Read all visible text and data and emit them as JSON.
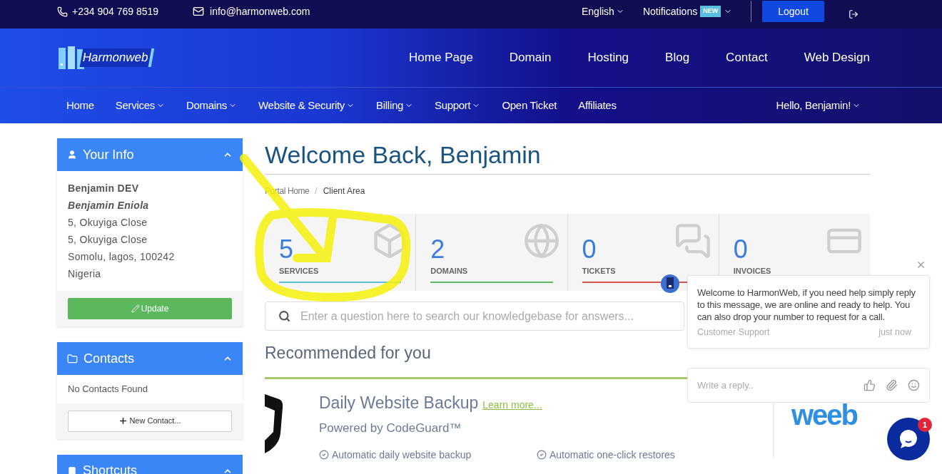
{
  "top_bar": {
    "phone": "+234 904 769 8519",
    "email": "info@harmonweb.com",
    "language": "English",
    "notifications": "Notifications",
    "notifications_badge": "NEW",
    "logout": "Logout"
  },
  "logo": {
    "text": "Harmonweb"
  },
  "main_nav": [
    "Home Page",
    "Domain",
    "Hosting",
    "Blog",
    "Contact",
    "Web Design"
  ],
  "sub_nav": [
    {
      "label": "Home",
      "dropdown": false
    },
    {
      "label": "Services",
      "dropdown": true
    },
    {
      "label": "Domains",
      "dropdown": true
    },
    {
      "label": "Website & Security",
      "dropdown": true
    },
    {
      "label": "Billing",
      "dropdown": true
    },
    {
      "label": "Support",
      "dropdown": true
    },
    {
      "label": "Open Ticket",
      "dropdown": false
    },
    {
      "label": "Affiliates",
      "dropdown": false
    }
  ],
  "user_menu": "Hello, Benjamin!",
  "sidebar": {
    "your_info": {
      "title": "Your Info",
      "expanded": true,
      "company": "Benjamin DEV",
      "name": "Benjamin Eniola",
      "lines": [
        "5, Okuyiga Close",
        "5, Okuyiga Close",
        "Somolu, lagos, 100242",
        "Nigeria"
      ],
      "button": "Update"
    },
    "contacts": {
      "title": "Contacts",
      "expanded": true,
      "empty": "No Contacts Found",
      "button": "New Contact..."
    },
    "shortcuts": {
      "title": "Shortcuts",
      "expanded": true
    }
  },
  "page_title": "Welcome Back, Benjamin",
  "breadcrumb": {
    "separator": "/",
    "items": [
      {
        "label": "Portal Home",
        "selected": false
      },
      {
        "label": "Client Area",
        "selected": true
      }
    ]
  },
  "stats": [
    {
      "kind": "box",
      "value": "5",
      "label": "SERVICES",
      "color": "#5bc0de"
    },
    {
      "kind": "globe",
      "value": "2",
      "label": "DOMAINS",
      "color": "#5cb85c"
    },
    {
      "kind": "comments",
      "value": "0",
      "label": "TICKETS",
      "color": "#d9534f"
    },
    {
      "kind": "card",
      "value": "0",
      "label": "INVOICES"
    }
  ],
  "kb_search": {
    "placeholder": "Enter a question here to search our knowledgebase for answers..."
  },
  "recommended": {
    "title": "Recommended for you",
    "product": "Daily Website Backup",
    "link": "Learn more...",
    "subtitle": "Powered by CodeGuard™",
    "features": [
      "Automatic daily website backup",
      "Automatic one-click restores"
    ],
    "partner_logo": "weeb"
  },
  "chat": {
    "message": "Welcome to HarmonWeb, if you need help simply reply to this message, we are online and ready to help. You can also drop your number to request for a call.",
    "sender": "Customer Support",
    "time": "just now",
    "reply_placeholder": "Write a reply..",
    "badge": "1"
  }
}
